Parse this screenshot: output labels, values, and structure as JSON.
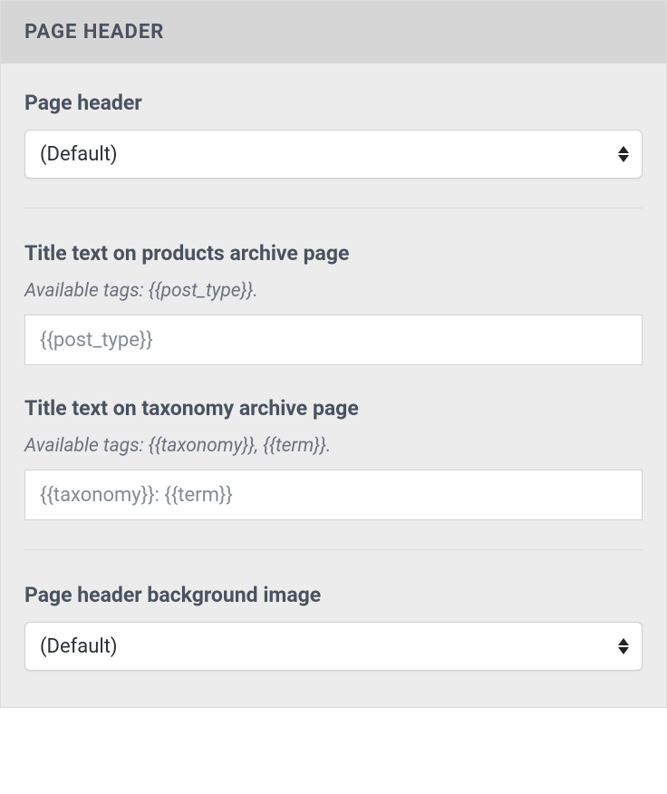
{
  "panel": {
    "title": "PAGE HEADER"
  },
  "fields": {
    "page_header": {
      "label": "Page header",
      "value": "(Default)"
    },
    "title_products": {
      "label": "Title text on products archive page",
      "hint": "Available tags: {{post_type}}.",
      "placeholder": "{{post_type}}",
      "value": ""
    },
    "title_taxonomy": {
      "label": "Title text on taxonomy archive page",
      "hint": "Available tags: {{taxonomy}}, {{term}}.",
      "placeholder": "{{taxonomy}}: {{term}}",
      "value": ""
    },
    "bg_image": {
      "label": "Page header background image",
      "value": "(Default)"
    }
  }
}
